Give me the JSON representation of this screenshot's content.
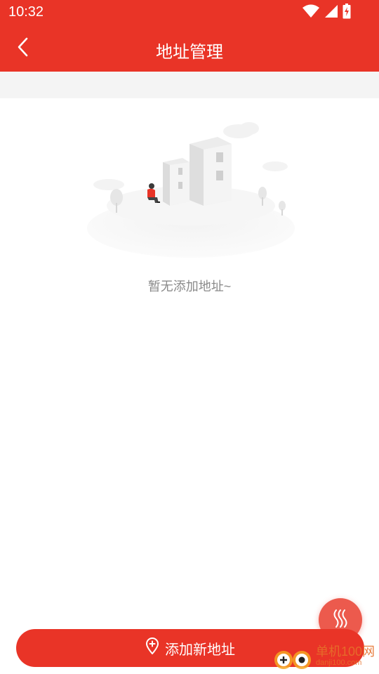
{
  "status_bar": {
    "time": "10:32",
    "icons": [
      "wifi-icon",
      "signal-icon",
      "battery-charging-icon"
    ]
  },
  "header": {
    "back_icon": "chevron-left-icon",
    "title": "地址管理"
  },
  "empty_state": {
    "illustration": "empty-city-illustration",
    "message": "暂无添加地址~"
  },
  "footer": {
    "add_button_icon": "location-plus-icon",
    "add_button_label": "添加新地址"
  },
  "floating_button": {
    "icon": "heat-waves-icon"
  },
  "watermark": {
    "title": "单机100网",
    "url": "danji100.com"
  },
  "colors": {
    "accent": "#e93427",
    "background": "#ffffff",
    "band": "#f4f4f4",
    "empty_text": "#8a8a8a",
    "watermark": "#e6702a"
  }
}
